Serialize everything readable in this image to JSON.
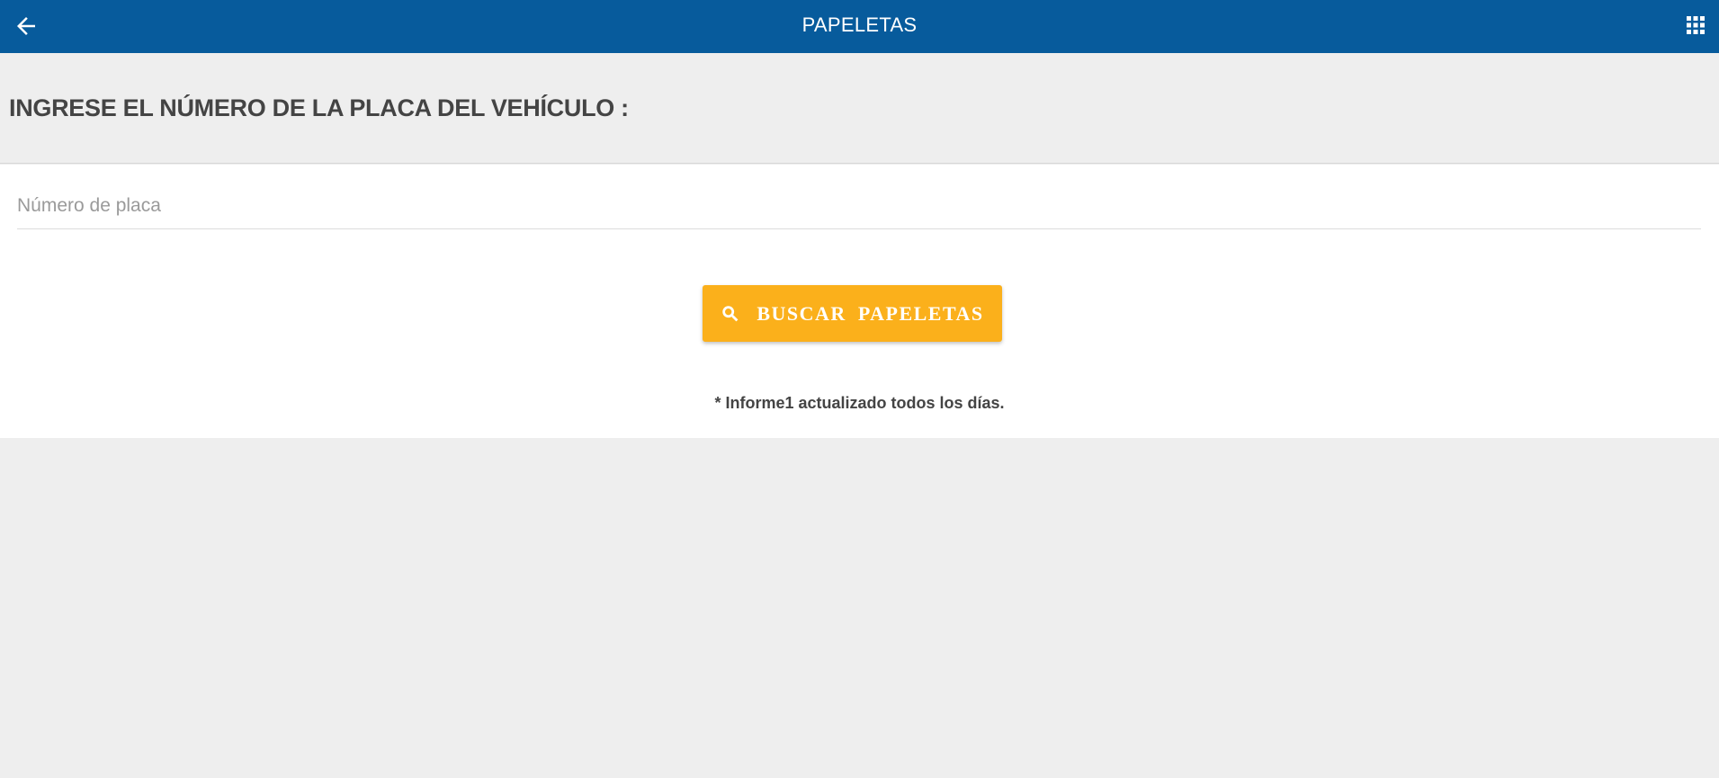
{
  "header": {
    "title": "PAPELETAS",
    "back_icon": "arrow-left-icon",
    "apps_icon": "grid-apps-icon",
    "background_color": "#075b9c"
  },
  "prompt": {
    "text": "INGRESE EL NÚMERO DE LA PLACA DEL VEHÍCULO :"
  },
  "form": {
    "plate_input": {
      "value": "",
      "placeholder": "Número de placa"
    },
    "search_button": {
      "label": "BUSCAR  PAPELETAS",
      "icon": "search-icon",
      "color": "#fbb01b"
    },
    "note": "* Informe1 actualizado todos los días."
  }
}
